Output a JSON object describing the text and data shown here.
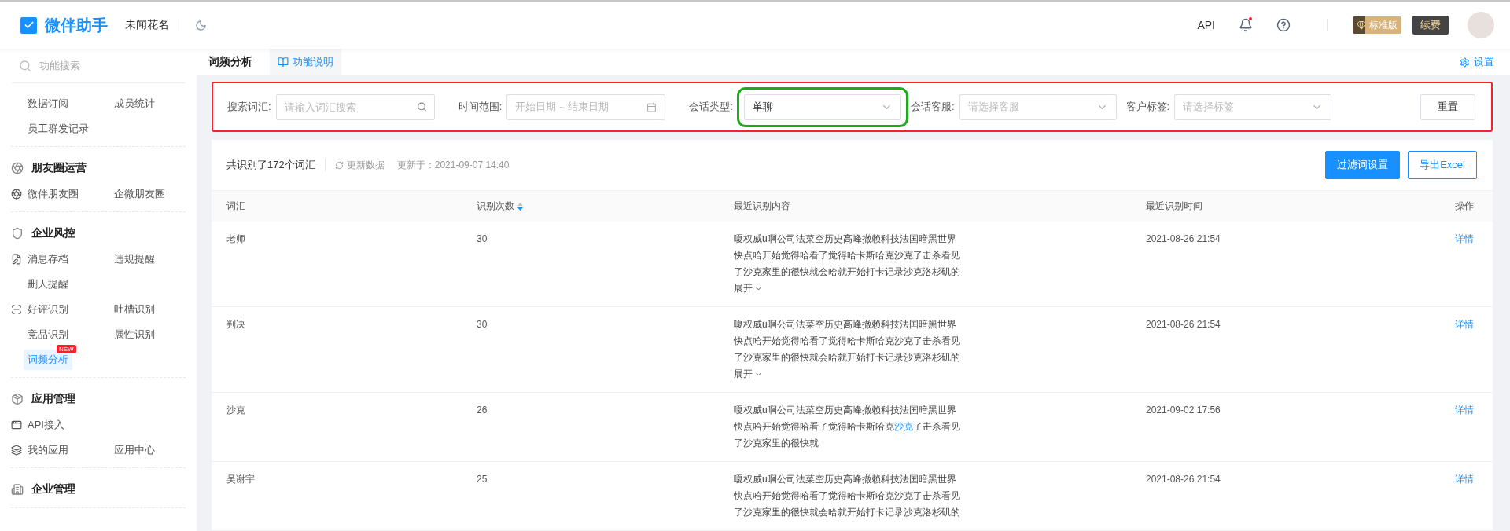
{
  "header": {
    "app_name": "微伴助手",
    "user_name": "未闻花名",
    "links": [
      "API"
    ],
    "notifications_unread": true,
    "plan_badge": "标准版",
    "renew_button": "续费"
  },
  "sidebar": {
    "search_placeholder": "功能搜索",
    "sections": [
      {
        "rows": [
          [
            {
              "label": "数据订阅",
              "icon": false,
              "selected": false
            },
            {
              "label": "成员统计",
              "icon": false,
              "selected": false
            }
          ],
          [
            {
              "label": "员工群发记录",
              "icon": false,
              "selected": false
            }
          ]
        ]
      },
      {
        "title": "朋友圈运营",
        "rows": [
          [
            {
              "label": "微伴朋友圈",
              "icon": true,
              "selected": false
            },
            {
              "label": "企微朋友圈",
              "icon": false,
              "selected": false
            }
          ]
        ]
      },
      {
        "title": "企业风控",
        "rows": [
          [
            {
              "label": "消息存档",
              "icon": true,
              "selected": false
            },
            {
              "label": "违规提醒",
              "icon": false,
              "selected": false
            }
          ],
          [
            {
              "label": "删人提醒",
              "icon": false,
              "selected": false
            }
          ],
          [
            {
              "label": "好评识别",
              "icon": true,
              "selected": false
            },
            {
              "label": "吐槽识别",
              "icon": false,
              "selected": false
            }
          ],
          [
            {
              "label": "竞品识别",
              "icon": false,
              "selected": false
            },
            {
              "label": "属性识别",
              "icon": false,
              "selected": false
            }
          ],
          [
            {
              "label": "词频分析",
              "icon": false,
              "selected": true,
              "badge": "NEW"
            }
          ]
        ]
      },
      {
        "title": "应用管理",
        "rows": [
          [
            {
              "label": "API接入",
              "icon": true,
              "selected": false
            }
          ],
          [
            {
              "label": "我的应用",
              "icon": true,
              "selected": false
            },
            {
              "label": "应用中心",
              "icon": false,
              "selected": false
            }
          ]
        ]
      },
      {
        "title": "企业管理"
      }
    ]
  },
  "page": {
    "title": "词频分析",
    "help_link": "功能说明",
    "settings_link": "设置"
  },
  "filter_bar": {
    "highlighted": true,
    "fields": [
      {
        "kind": "search",
        "label": "搜索词汇:",
        "placeholder": "请输入词汇搜索"
      },
      {
        "kind": "date",
        "label": "时间范围:",
        "start_placeholder": "开始日期",
        "separator": "~",
        "end_placeholder": "结束日期"
      },
      {
        "kind": "select",
        "label": "会话类型:",
        "value": "单聊",
        "highlighted": true
      },
      {
        "kind": "select",
        "label": "会话客服:",
        "placeholder": "请选择客服"
      },
      {
        "kind": "select",
        "label": "客户标签:",
        "placeholder": "请选择标签"
      }
    ],
    "reset_button": "重置"
  },
  "summary": {
    "total": "共识别了172个词汇",
    "refresh": "更新数据",
    "updated": "更新于：2021-09-07 14:40",
    "buttons": [
      {
        "label": "过滤词设置",
        "kind": "primary"
      },
      {
        "label": "导出Excel",
        "kind": "outline"
      }
    ]
  },
  "table": {
    "columns": [
      {
        "label": "词汇",
        "sortable": false
      },
      {
        "label": "识别次数",
        "sortable": true
      },
      {
        "label": "最近识别内容",
        "sortable": false
      },
      {
        "label": "最近识别时间",
        "sortable": false
      },
      {
        "label": "操作",
        "sortable": false
      }
    ],
    "rows": [
      {
        "word": "老师",
        "count": "30",
        "lines": [
          [
            {
              "text": "嗄权威u啊公司法菜空历史高峰撤赖科技法国暗黑世界",
              "highlight": false
            }
          ],
          [
            {
              "text": "快点哈开始觉得哈看了觉得哈卡斯哈克沙克了击杀看见",
              "highlight": false
            }
          ],
          [
            {
              "text": "了沙克家里的很快就会哈就开始打卡记录沙克洛杉矶的",
              "highlight": false
            }
          ]
        ],
        "expand": "展开",
        "time": "2021-08-26 21:54",
        "action": "详情"
      },
      {
        "word": "判决",
        "count": "30",
        "lines": [
          [
            {
              "text": "嗄权威u啊公司法菜空历史高峰撤赖科技法国暗黑世界",
              "highlight": false
            }
          ],
          [
            {
              "text": "快点哈开始觉得哈看了觉得哈卡斯哈克沙克了击杀看见",
              "highlight": false
            }
          ],
          [
            {
              "text": "了沙克家里的很快就会哈就开始打卡记录沙克洛杉矶的",
              "highlight": false
            }
          ]
        ],
        "expand": "展开",
        "time": "2021-08-26 21:54",
        "action": "详情"
      },
      {
        "word": "沙克",
        "count": "26",
        "lines": [
          [
            {
              "text": "嗄权威u啊公司法菜空历史高峰撤赖科技法国暗黑世界",
              "highlight": false
            }
          ],
          [
            {
              "text": "快点哈开始觉得哈看了觉得哈卡斯哈克",
              "highlight": false
            },
            {
              "text": "沙克",
              "highlight": true
            },
            {
              "text": "了击杀看见",
              "highlight": false
            }
          ],
          [
            {
              "text": "了沙克家里的很快就",
              "highlight": false
            }
          ]
        ],
        "time": "2021-09-02 17:56",
        "action": "详情"
      },
      {
        "word": "吴谢宇",
        "count": "25",
        "lines": [
          [
            {
              "text": "嗄权威u啊公司法菜空历史高峰撤赖科技法国暗黑世界",
              "highlight": false
            }
          ],
          [
            {
              "text": "快点哈开始觉得哈看了觉得哈卡斯哈克沙克了击杀看见",
              "highlight": false
            }
          ],
          [
            {
              "text": "了沙克家里的很快就会哈就开始打卡记录沙克洛杉矶的",
              "highlight": false
            }
          ]
        ],
        "time": "2021-08-26 21:54",
        "action": "详情"
      }
    ]
  }
}
